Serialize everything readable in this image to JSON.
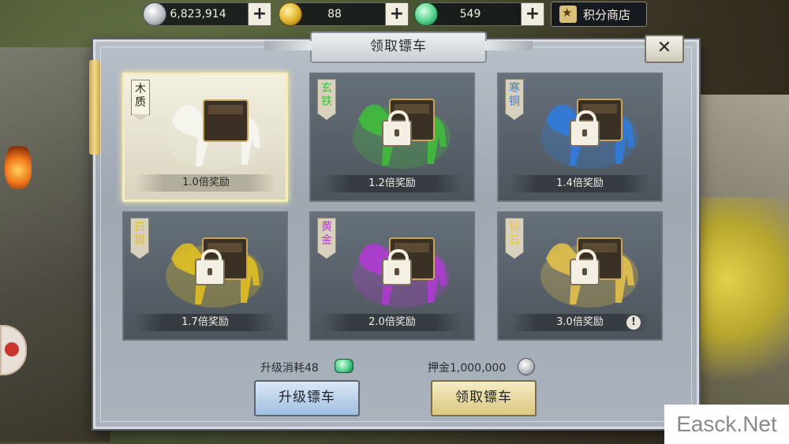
{
  "resources": {
    "silver": "6,823,914",
    "gold": "88",
    "jade": "549",
    "plus": "+"
  },
  "shop": {
    "label": "积分商店"
  },
  "dialog": {
    "title": "领取镖车",
    "close": "✕"
  },
  "cards": [
    {
      "tag": "木质",
      "reward": "1.0倍奖励",
      "locked": false,
      "color": "#ffffff"
    },
    {
      "tag": "玄铁",
      "reward": "1.2倍奖励",
      "locked": true,
      "color": "#3fbf3a"
    },
    {
      "tag": "寒铜",
      "reward": "1.4倍奖励",
      "locked": true,
      "color": "#2f7de0"
    },
    {
      "tag": "白银",
      "reward": "1.7倍奖励",
      "locked": true,
      "color": "#e6c21e"
    },
    {
      "tag": "黄金",
      "reward": "2.0倍奖励",
      "locked": true,
      "color": "#b23ad6"
    },
    {
      "tag": "钻石",
      "reward": "3.0倍奖励",
      "locked": true,
      "color": "#e8c44a",
      "info": "!"
    }
  ],
  "footer": {
    "upgrade_cost": "升级消耗48",
    "deposit": "押金1,000,000",
    "upgrade_button": "升级镖车",
    "claim_button": "领取镖车"
  },
  "watermark": "Easck.Net"
}
